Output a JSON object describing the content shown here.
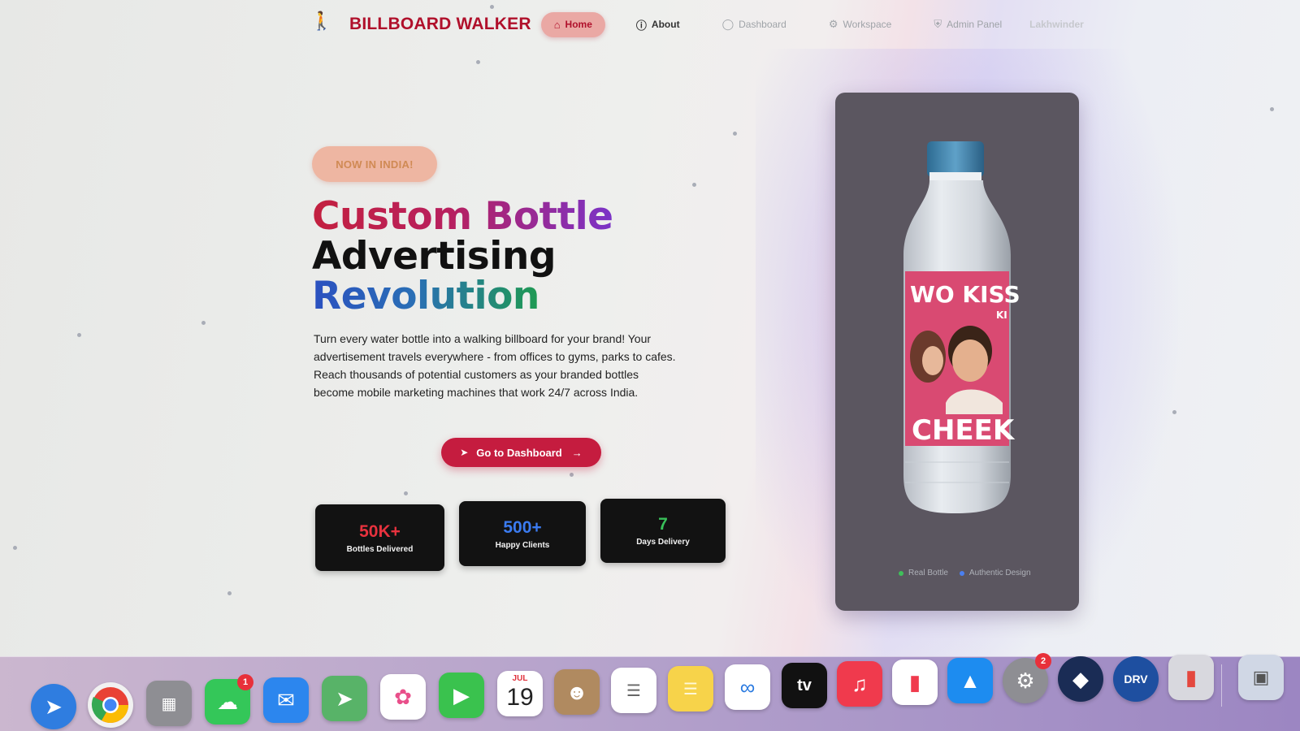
{
  "nav": {
    "logo_text": "BILLBOARD WALKER",
    "brand": "BILLBOARD WALKER",
    "items": [
      {
        "label": "Home",
        "icon": "home-icon"
      },
      {
        "label": "About",
        "icon": "info-icon"
      },
      {
        "label": "Dashboard",
        "icon": "dashboard-icon"
      },
      {
        "label": "Workspace",
        "icon": "workspace-icon"
      },
      {
        "label": "Admin Panel",
        "icon": "shield-icon"
      }
    ],
    "user": "Lakhwinder"
  },
  "hero": {
    "badge": "NOW IN INDIA!",
    "title_line1": "Custom Bottle",
    "title_line2": "Advertising",
    "title_line3": "Revolution",
    "description": "Turn every water bottle into a walking billboard for your brand! Your advertisement travels everywhere - from offices to gyms, parks to cafes. Reach thousands of potential customers as your branded bottles become mobile marketing machines that work 24/7 across India.",
    "cta_label": "Go to Dashboard"
  },
  "stats": [
    {
      "value": "50K+",
      "label": "Bottles Delivered",
      "color": "#e8323e"
    },
    {
      "value": "500+",
      "label": "Happy Clients",
      "color": "#3b7bf0"
    },
    {
      "value": "7",
      "label": "Days Delivery",
      "color": "#39c05a"
    }
  ],
  "product": {
    "label_top": "WO KISS",
    "label_top_small": "KI",
    "label_bottom": "CHEEK",
    "meta": [
      {
        "label": "Real Bottle",
        "color": "#3fbf5a"
      },
      {
        "label": "Authentic Design",
        "color": "#4a7ff0"
      }
    ]
  },
  "dock": {
    "apps": [
      {
        "name": "safari-icon",
        "color": "#2f7de0"
      },
      {
        "name": "chrome-icon",
        "color": "#f1f1f1"
      },
      {
        "name": "launchpad-icon",
        "color": "#8e8e93"
      },
      {
        "name": "messages-icon",
        "color": "#34c759",
        "badge": "1"
      },
      {
        "name": "mail-icon",
        "color": "#2c86ee"
      },
      {
        "name": "maps-icon",
        "color": "#58b368"
      },
      {
        "name": "photos-icon",
        "color": "#ffffff"
      },
      {
        "name": "facetime-icon",
        "color": "#3ac24e"
      },
      {
        "name": "calendar-icon",
        "color": "#ffffff",
        "month": "JUL",
        "day": "19"
      },
      {
        "name": "contacts-icon",
        "color": "#b08a60"
      },
      {
        "name": "reminders-icon",
        "color": "#ffffff"
      },
      {
        "name": "notes-icon",
        "color": "#f7d34a"
      },
      {
        "name": "freeform-icon",
        "color": "#ffffff"
      },
      {
        "name": "tv-icon",
        "color": "#111111",
        "text": "tv"
      },
      {
        "name": "music-icon",
        "color": "#f03a4d"
      },
      {
        "name": "news-icon",
        "color": "#ffffff"
      },
      {
        "name": "app-store-icon",
        "color": "#1d8cf0"
      },
      {
        "name": "system-settings-icon",
        "color": "#8e8e93",
        "badge": "2"
      },
      {
        "name": "instruments-icon",
        "color": "#1a2c55"
      },
      {
        "name": "drv-icon",
        "color": "#1e4fa0",
        "text": "DRV"
      },
      {
        "name": "iphone-mirroring-icon",
        "color": "#d8d8de"
      },
      {
        "name": "finder-window-icon",
        "color": "#d0d7e5"
      }
    ]
  }
}
